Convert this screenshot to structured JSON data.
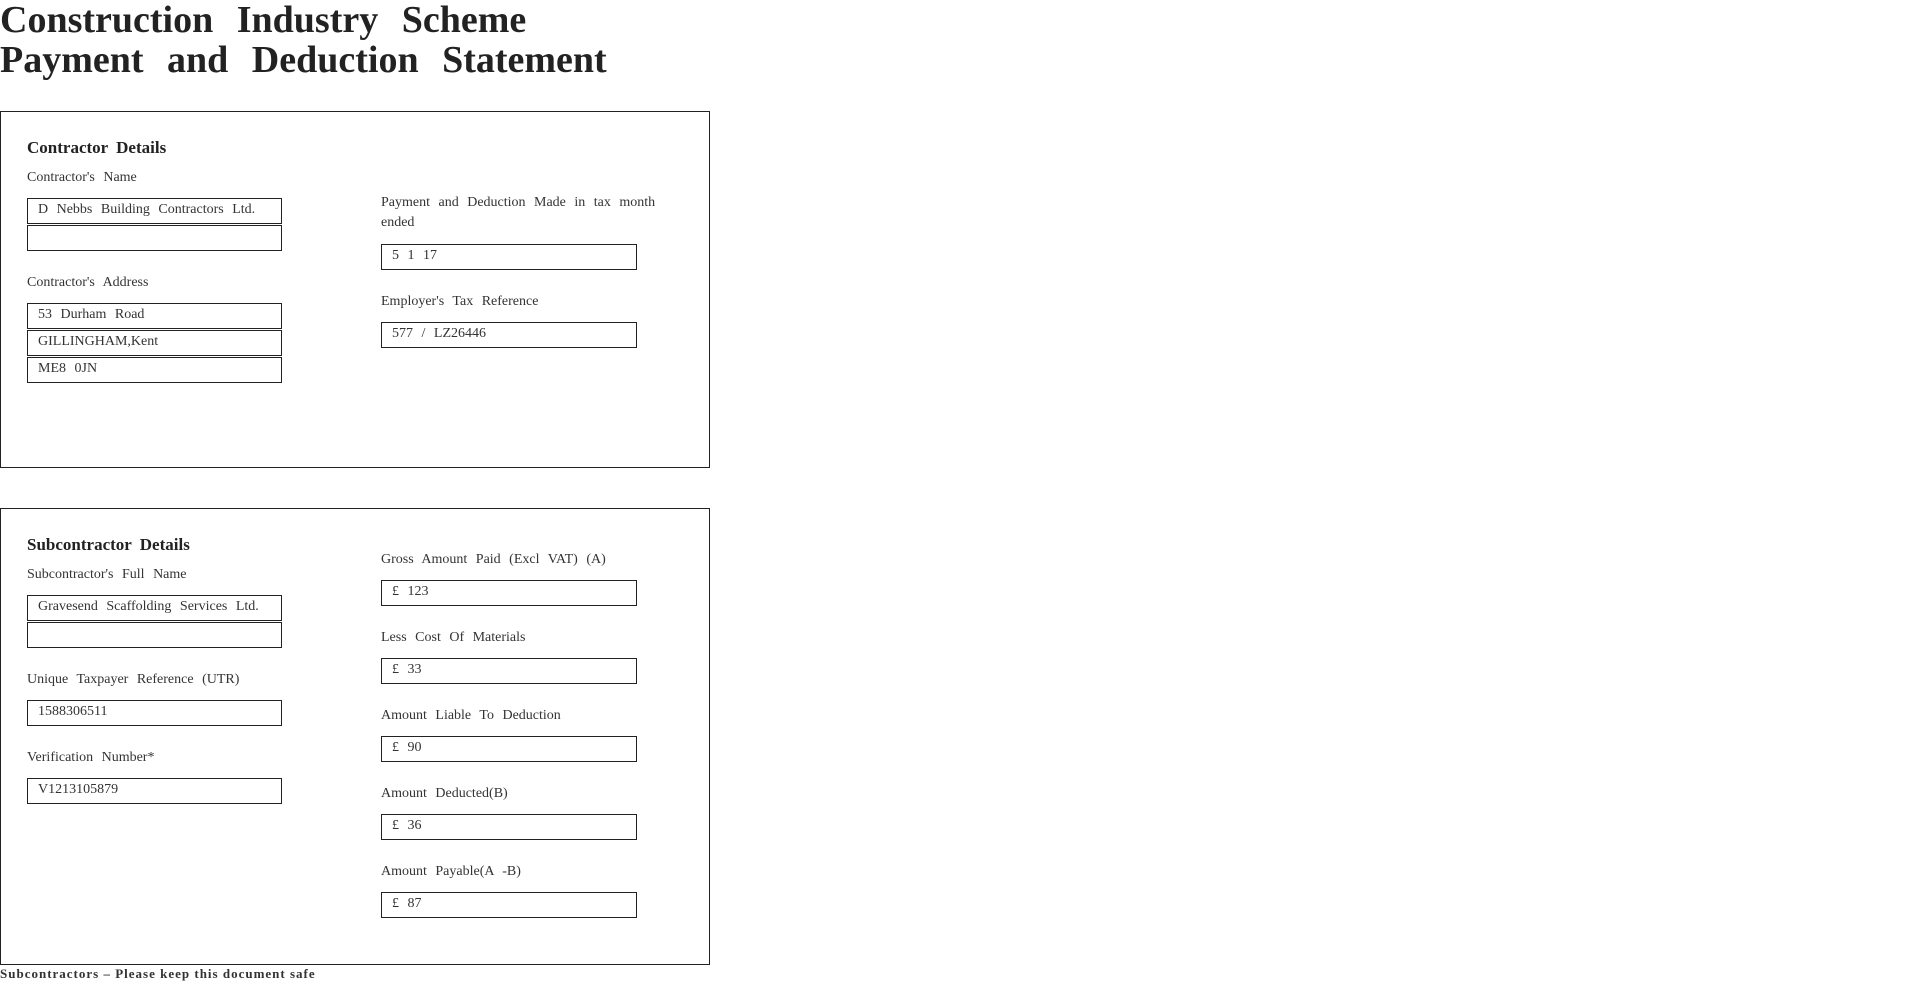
{
  "header": {
    "title_line1": "Construction Industry Scheme",
    "title_line2": "Payment and Deduction Statement"
  },
  "contractor": {
    "heading": "Contractor Details",
    "name_label": "Contractor's Name",
    "name_line1": "D Nebbs Building Contractors Ltd.",
    "name_line2": "",
    "address_label": "Contractor's Address",
    "address_line1": "53 Durham Road",
    "address_line2": "GILLINGHAM,Kent",
    "address_line3": "ME8 0JN",
    "tax_month_label": "Payment and Deduction Made in tax month ended",
    "tax_month_value": "5 1 17",
    "employer_ref_label": "Employer's Tax Reference",
    "employer_ref_value": "577 / LZ26446"
  },
  "subcontractor": {
    "heading": "Subcontractor Details",
    "name_label": "Subcontractor's Full Name",
    "name_line1": "Gravesend Scaffolding Services Ltd.",
    "name_line2": "",
    "utr_label": "Unique Taxpayer Reference (UTR)",
    "utr_value": "1588306511",
    "verification_label": "Verification Number*",
    "verification_value": "V1213105879",
    "gross_label": "Gross Amount Paid (Excl VAT) (A)",
    "gross_value": "£ 123",
    "materials_label": "Less Cost Of Materials",
    "materials_value": "£ 33",
    "liable_label": "Amount Liable To Deduction",
    "liable_value": "£ 90",
    "deducted_label": "Amount Deducted(B)",
    "deducted_value": "£ 36",
    "payable_label": "Amount Payable(A -B)",
    "payable_value": "£ 87"
  },
  "footer": {
    "note": "Subcontractors – Please keep this document safe"
  }
}
